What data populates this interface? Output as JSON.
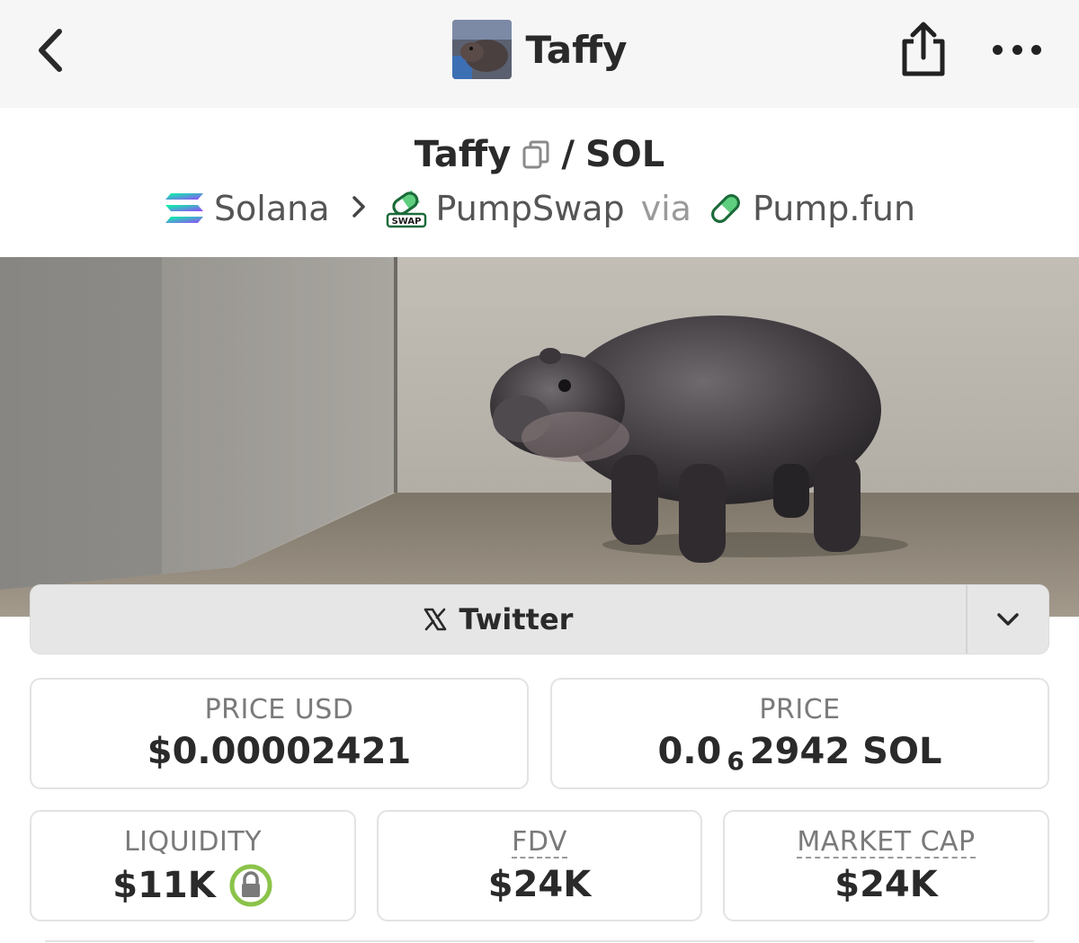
{
  "nav": {
    "title": "Taffy",
    "back_icon": "chevron-left-icon",
    "share_icon": "share-icon",
    "more_icon": "more-horizontal-icon"
  },
  "pair": {
    "base": "Taffy",
    "slash": "/",
    "quote": "SOL"
  },
  "breadcrumb": {
    "chain": "Solana",
    "dex": "PumpSwap",
    "via_word": "via",
    "launchpad": "Pump.fun",
    "dex_badge_text": "SWAP"
  },
  "socials": {
    "twitter_label": "Twitter"
  },
  "stats": {
    "price_usd": {
      "label": "PRICE USD",
      "value": "$0.00002421"
    },
    "price": {
      "label": "PRICE",
      "lead": "0.0",
      "zeros": "6",
      "digits": "2942",
      "unit": "SOL"
    },
    "liquidity": {
      "label": "LIQUIDITY",
      "value": "$11K"
    },
    "fdv": {
      "label": "FDV",
      "value": "$24K"
    },
    "market_cap": {
      "label": "MARKET CAP",
      "value": "$24K"
    }
  },
  "colors": {
    "solana_gradient": [
      "#00ffa3",
      "#9945ff"
    ],
    "pump_green": "#5fcf7f",
    "lock_green": "#8bc34a"
  }
}
